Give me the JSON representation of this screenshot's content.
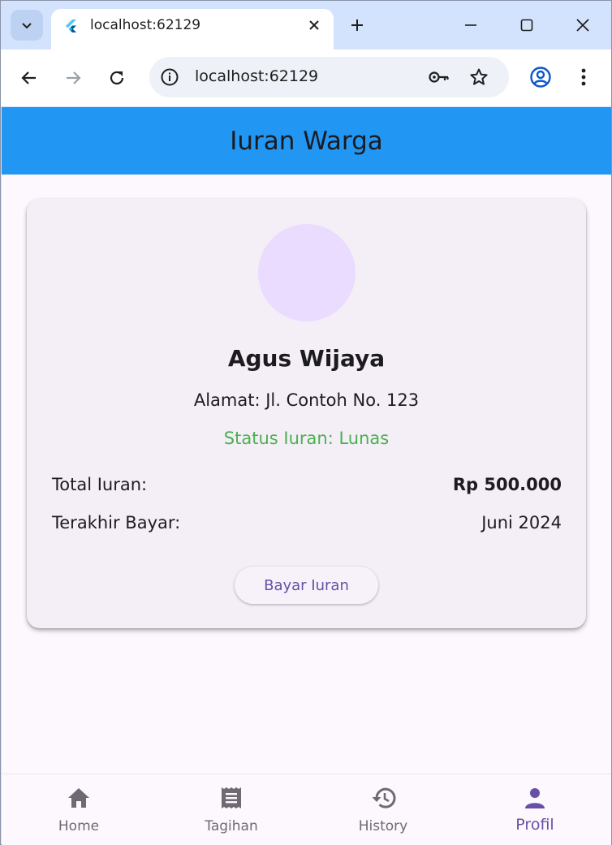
{
  "browser": {
    "tab": {
      "title": "localhost:62129"
    },
    "omnibox": {
      "url": "localhost:62129"
    },
    "icons": {
      "tab_list": "chevron-down-icon",
      "favicon": "flutter-icon",
      "tab_close": "close-icon",
      "new_tab": "plus-icon",
      "minimize": "minimize-icon",
      "maximize": "maximize-icon",
      "close_window": "close-icon",
      "back": "arrow-left-icon",
      "forward": "arrow-right-icon",
      "reload": "reload-icon",
      "site_info": "info-icon",
      "passwords": "key-icon",
      "bookmark": "star-icon",
      "profile": "account-circle-icon",
      "menu": "more-vert-icon"
    }
  },
  "app": {
    "appbar": {
      "title": "Iuran Warga",
      "color": "#2196f3"
    },
    "profile_card": {
      "name": "Agus Wijaya",
      "address": "Alamat: Jl. Contoh No. 123",
      "status": "Status Iuran: Lunas",
      "status_color": "#4caf50",
      "rows": [
        {
          "label": "Total Iuran:",
          "value": "Rp 500.000"
        },
        {
          "label": "Terakhir Bayar:",
          "value": "Juni 2024"
        }
      ],
      "pay_button": "Bayar Iuran"
    },
    "bottom_nav": {
      "items": [
        {
          "label": "Home",
          "icon": "home-icon"
        },
        {
          "label": "Tagihan",
          "icon": "receipt-icon"
        },
        {
          "label": "History",
          "icon": "history-icon"
        },
        {
          "label": "Profil",
          "icon": "person-icon",
          "active": true
        }
      ],
      "active_color": "#6750a4"
    }
  }
}
